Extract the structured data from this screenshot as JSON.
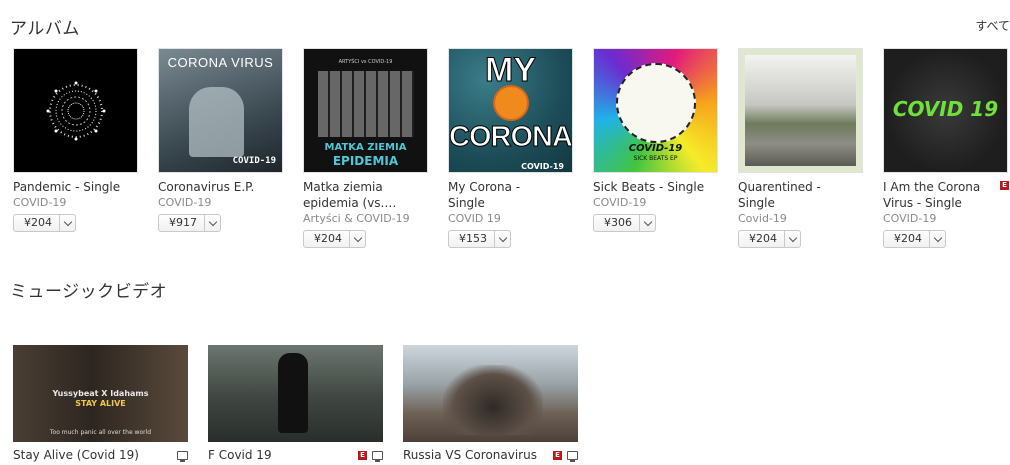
{
  "albums_section": {
    "title": "アルバム",
    "see_all": "すべて"
  },
  "albums": [
    {
      "title": "Pandemic - Single",
      "artist": "COVID-19",
      "price": "¥204"
    },
    {
      "title": "Coronavirus E.P.",
      "artist": "COVID-19",
      "price": "¥917",
      "cover_text": "CORONA VIRUS",
      "cover_sub": "COVID-19"
    },
    {
      "title": "Matka ziemia epidemia (vs. COVI...",
      "artist": "Artyści & COVID-19",
      "price": "¥204",
      "cover_top": "ARTYŚCI vs COVID-19",
      "cover_text": "MATKA ZIEMIA",
      "cover_sub": "EPIDEMIA"
    },
    {
      "title": "My Corona - Single",
      "artist": "COVID 19",
      "price": "¥153",
      "cover_text": "MY",
      "cover_sub": "CORONA",
      "cover_small": "COVID-19"
    },
    {
      "title": "Sick Beats - Single",
      "artist": "COVID-19",
      "price": "¥306",
      "cover_text": "COVID-19",
      "cover_sub": "SICK BEATS EP"
    },
    {
      "title": "Quarentined - Single",
      "artist": "Covid-19",
      "price": "¥204"
    },
    {
      "title": "I Am the Corona Virus - Single",
      "artist": "COVID-19",
      "price": "¥204",
      "explicit": "E",
      "cover_text": "COVID 19"
    }
  ],
  "videos_section": {
    "title": "ミュージックビデオ"
  },
  "videos": [
    {
      "title": "Stay Alive (Covid 19)",
      "overlay_top": "Yussybeat X Idahams",
      "overlay_mid": "STAY ALIVE",
      "overlay_bottom": "Too much panic all over the world"
    },
    {
      "title": "F Covid 19",
      "explicit": "E"
    },
    {
      "title": "Russia VS Coronavirus",
      "explicit": "E"
    }
  ],
  "colors": {
    "explicit_badge": "#b8191c",
    "text": "#333333",
    "subtext": "#8a8a8a"
  },
  "icons": {
    "dropdown": "chevron-down-icon",
    "video": "tv-icon",
    "explicit": "explicit-badge"
  }
}
